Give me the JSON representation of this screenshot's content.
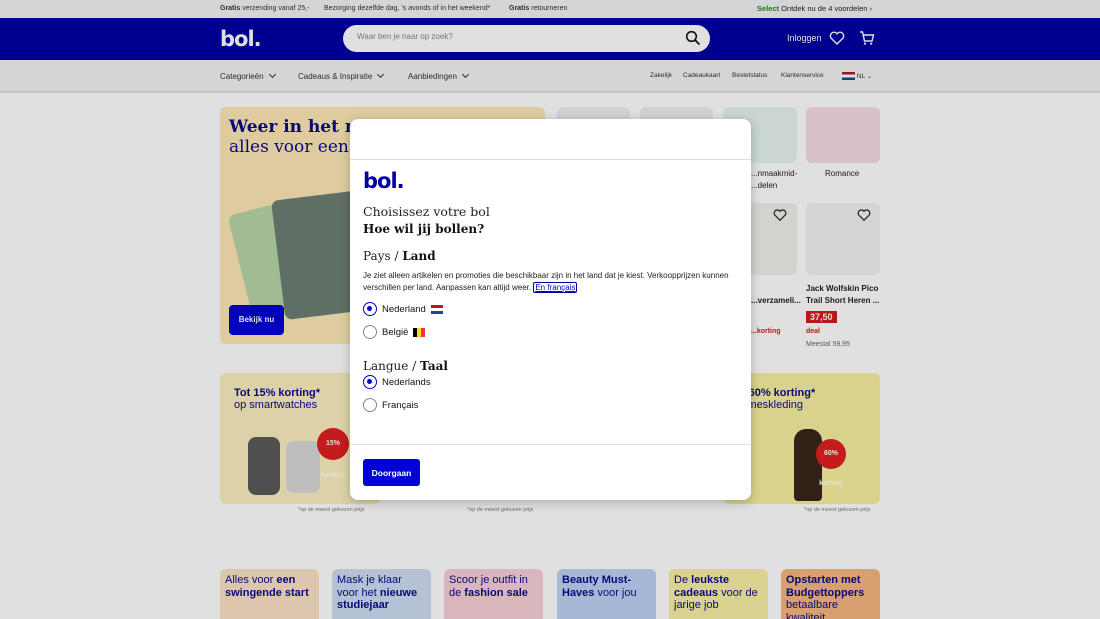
{
  "topbar": {
    "usp1_bold": "Gratis",
    "usp1_text": "verzending vanaf 25,-",
    "usp2_text": "Bezorging dezelfde dag, 's avonds of in het weekend*",
    "usp3_bold": "Gratis",
    "usp3_text": "retourneren",
    "select_bold": "Select",
    "select_text": "Ontdek nu de 4 voordelen"
  },
  "header": {
    "logo": "bol.",
    "search_placeholder": "Waar ben je naar op zoek?",
    "login": "Inloggen"
  },
  "nav": {
    "left": [
      "Categorieën",
      "Cadeaus & Inspiratie",
      "Aanbiedingen"
    ],
    "right": [
      "Zakelijk",
      "Cadeaukaart",
      "Bestelstatus",
      "Klantenservice"
    ],
    "language": "NL"
  },
  "background": {
    "hero_line1": "Weer in het ritme",
    "hero_line2": "alles voor een s",
    "hero_button": "Bekijk nu",
    "product1_label": "...nmaakmid-",
    "product1_label2": "...delen",
    "product2_label": "Romance",
    "product3_label": "...verzameli...",
    "product3_badge": "...korting",
    "product4_label_line1": "Jack Wolfskin Pico",
    "product4_label_line2": "Trail Short Heren ...",
    "product4_price": "37,50",
    "product4_deal": "deal",
    "product4_was": "Meestal 59,95",
    "promo1_line1": "Tot 15% korting*",
    "promo1_line2": "op smartwatches",
    "promo1_badge": "15% korting",
    "promo2_line1": "...ot 60% korting*",
    "promo2_line2": "...dameskleding",
    "promo2_badge": "60% korting",
    "fineprint": "*op de meest gekozen prijs",
    "cards": [
      {
        "pre": "Alles voor ",
        "bold": "een swingende start",
        "post": ""
      },
      {
        "pre": "Mask je klaar voor het ",
        "bold": "nieuwe studiejaar",
        "post": ""
      },
      {
        "pre": "Scoor je outfit in de ",
        "bold": "fashion sale",
        "post": ""
      },
      {
        "pre": "",
        "bold": "Beauty Must-Haves",
        "post": " voor jou"
      },
      {
        "pre": "De ",
        "bold": "leukste cadeaus",
        "post": " voor de jarige job"
      },
      {
        "pre": "",
        "bold": "Opstarten met Budgettoppers",
        "post": " betaalbare kwaliteit"
      }
    ]
  },
  "modal": {
    "logo": "bol.",
    "heading_fr": "Choisissez votre bol",
    "heading_nl": "Hoe wil jij bollen?",
    "country_prefix": "Pays / ",
    "country_bold": "Land",
    "info_text": "Je ziet alleen artikelen en promoties die beschikbaar zijn in het land dat je kiest. Verkoopprijzen kunnen verschillen per land. Aanpassen kan altijd weer.",
    "info_link": "En français",
    "countries": [
      {
        "label": "Nederland",
        "selected": true,
        "flag": "nl-flag-icon"
      },
      {
        "label": "België",
        "selected": false,
        "flag": "be-flag-icon"
      }
    ],
    "language_prefix": "Langue / ",
    "language_bold": "Taal",
    "languages": [
      {
        "label": "Nederlands",
        "selected": true
      },
      {
        "label": "Français",
        "selected": false
      }
    ],
    "continue_button": "Doorgaan"
  },
  "colors": {
    "brand_blue": "#0000a4",
    "button_blue": "#0000d8",
    "select_green": "#1a8c1a"
  }
}
